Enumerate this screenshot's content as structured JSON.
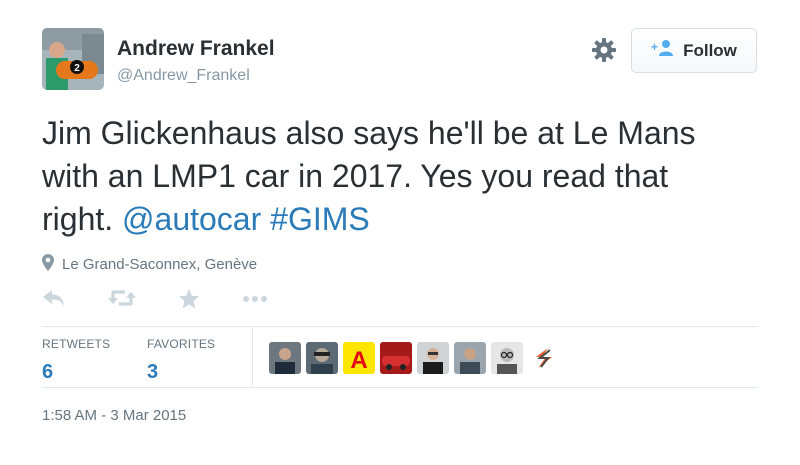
{
  "author": {
    "name": "Andrew Frankel",
    "handle": "@Andrew_Frankel",
    "avatar_icon": "profile-photo"
  },
  "header": {
    "settings_icon": "gear-icon",
    "follow_label": "Follow",
    "follow_icon": "add-user-icon"
  },
  "tweet": {
    "text_plain": "Jim Glickenhaus also says he'll be at Le Mans with an LMP1 car in 2017. Yes you read that right.",
    "mention": "@autocar",
    "hashtag": "#GIMS",
    "location": "Le Grand-Saconnex, Genève",
    "timestamp": "1:58 AM - 3 Mar 2015"
  },
  "actions": {
    "reply_icon": "reply-icon",
    "retweet_icon": "retweet-icon",
    "favorite_icon": "star-icon",
    "more_icon": "more-icon"
  },
  "stats": {
    "retweets_label": "RETWEETS",
    "retweets_count": "6",
    "favorites_label": "FAVORITES",
    "favorites_count": "3"
  },
  "favoriters": [
    {
      "avatar": "user-avatar-1",
      "letter": ""
    },
    {
      "avatar": "user-avatar-2",
      "letter": ""
    },
    {
      "avatar": "user-avatar-3",
      "letter": "A"
    },
    {
      "avatar": "user-avatar-4",
      "letter": ""
    },
    {
      "avatar": "user-avatar-5",
      "letter": ""
    },
    {
      "avatar": "user-avatar-6",
      "letter": ""
    },
    {
      "avatar": "user-avatar-7",
      "letter": ""
    },
    {
      "avatar": "user-avatar-8",
      "letter": ""
    }
  ],
  "colors": {
    "link": "#2b7bb9",
    "text": "#292f33",
    "muted": "#8899a6",
    "icon": "#ccd6dd",
    "avatar_badge": "#c8102e",
    "favoriter_a_bg": "#ffe600",
    "favoriter_a_fg": "#e30613"
  }
}
